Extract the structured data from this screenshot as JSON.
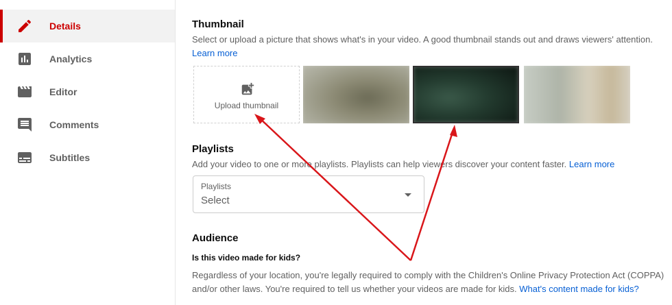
{
  "sidebar": {
    "items": [
      {
        "label": "Details",
        "icon": "pencil-icon",
        "active": true
      },
      {
        "label": "Analytics",
        "icon": "analytics-icon"
      },
      {
        "label": "Editor",
        "icon": "clapperboard-icon"
      },
      {
        "label": "Comments",
        "icon": "comment-icon"
      },
      {
        "label": "Subtitles",
        "icon": "subtitles-icon"
      }
    ]
  },
  "thumbnail": {
    "title": "Thumbnail",
    "description": "Select or upload a picture that shows what's in your video. A good thumbnail stands out and draws viewers' attention.",
    "learn_more": "Learn more",
    "upload_label": "Upload thumbnail"
  },
  "playlists": {
    "title": "Playlists",
    "description": "Add your video to one or more playlists. Playlists can help viewers discover your content faster.",
    "learn_more": "Learn more",
    "select_label": "Playlists",
    "select_value": "Select"
  },
  "audience": {
    "title": "Audience",
    "question": "Is this video made for kids?",
    "body_line1": "Regardless of your location, you're legally required to comply with the Children's Online Privacy Protection Act (COPPA)",
    "body_line2": "and/or other laws. You're required to tell us whether your videos are made for kids.",
    "body_link": "What's content made for kids?"
  },
  "colors": {
    "accent": "#cc0000",
    "link": "#065fd4",
    "arrow": "#d9161a"
  }
}
